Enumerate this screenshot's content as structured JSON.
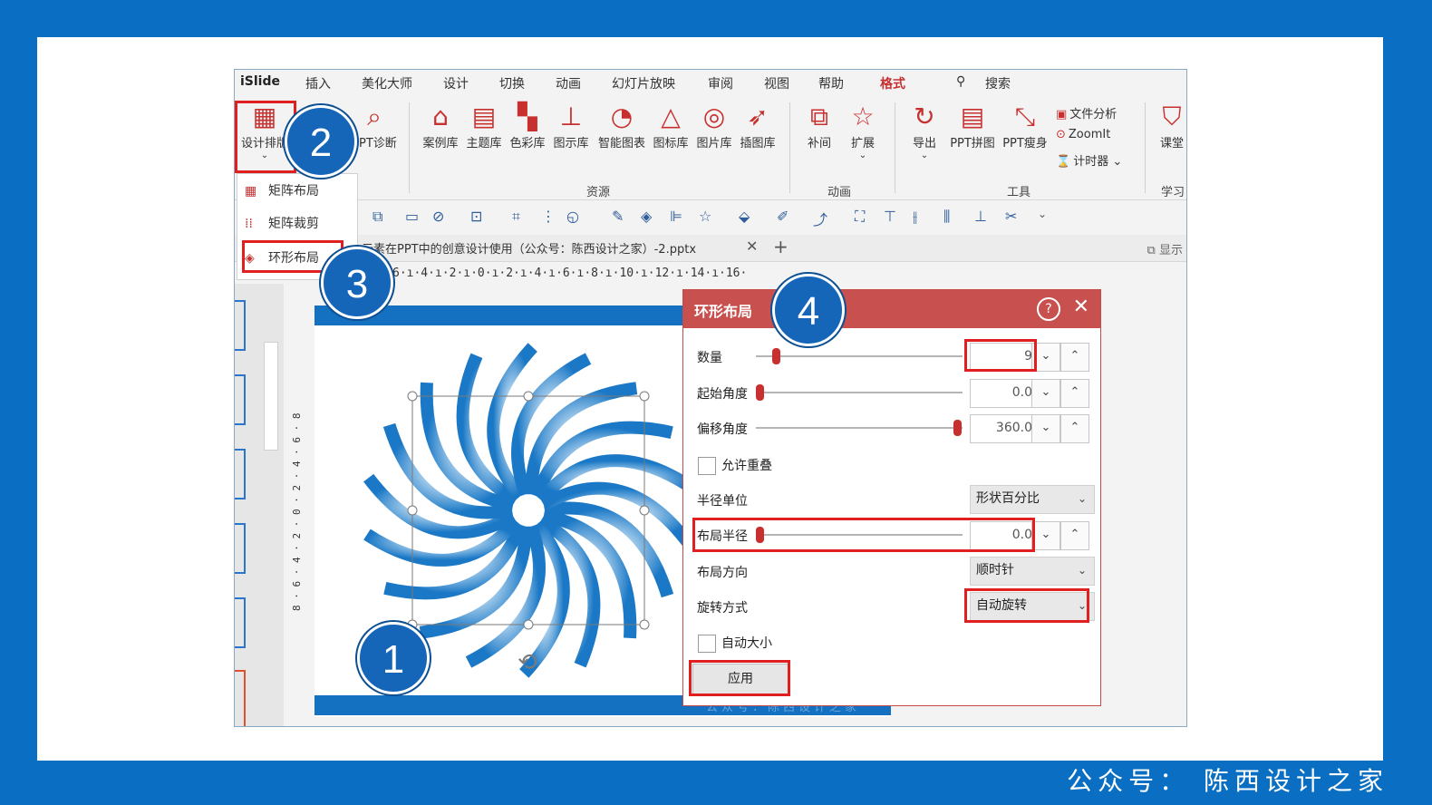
{
  "menubar": {
    "items": [
      "iSlide",
      "插入",
      "美化大师",
      "设计",
      "切换",
      "动画",
      "幻灯片放映",
      "审阅",
      "视图",
      "帮助",
      "格式"
    ],
    "search": "搜索"
  },
  "ribbon": {
    "design_layout": "设计排版",
    "ppt_diag": "PPT诊断",
    "resources": [
      "案例库",
      "主题库",
      "色彩库",
      "图示库",
      "智能图表",
      "图标库",
      "图片库",
      "插图库"
    ],
    "resources_group": "资源",
    "animation_items": [
      "补间",
      "扩展"
    ],
    "animation_group": "动画",
    "tools_items": [
      "导出",
      "PPT拼图",
      "PPT瘦身"
    ],
    "tools_small": [
      "文件分析",
      "ZoomIt",
      "计时器"
    ],
    "tools_group": "工具",
    "learn_item": "课堂",
    "learn_group": "学习"
  },
  "dropdown": {
    "items": [
      "矩阵布局",
      "矩阵裁剪",
      "环形布局"
    ]
  },
  "tabbar": {
    "doc_title": "元素在PPT中的创意设计使用（公众号：陈西设计之家）-2.pptx",
    "display": "显示"
  },
  "ruler": {
    "horizontal": "6·ı·4·ı·2·ı·0·ı·2·ı·4·ı·6·ı·8·ı·10·ı·12·ı·14·ı·16·",
    "vertical": "8 · 6 · 4 · 2 · 0 · 2 · 4 · 6 · 8"
  },
  "slide": {
    "footer_text": "公众号：陈西设计之家"
  },
  "dialog": {
    "title": "环形布局",
    "help_icon": "?",
    "rows": {
      "count_label": "数量",
      "count_value": "9",
      "start_angle_label": "起始角度",
      "start_angle_value": "0.0",
      "offset_angle_label": "偏移角度",
      "offset_angle_value": "360.0",
      "allow_overlap_label": "允许重叠",
      "radius_unit_label": "半径单位",
      "radius_unit_value": "形状百分比",
      "layout_radius_label": "布局半径",
      "layout_radius_value": "0.0",
      "direction_label": "布局方向",
      "direction_value": "顺时针",
      "rotation_label": "旋转方式",
      "rotation_value": "自动旋转",
      "auto_size_label": "自动大小"
    },
    "apply_label": "应用"
  },
  "steps": [
    "1",
    "2",
    "3",
    "4"
  ],
  "footer": {
    "brand": "公众号： 陈西设计之家"
  },
  "colors": {
    "frame": "#0a6fc2",
    "accent": "#c8302f",
    "dialog_title": "#c8504e",
    "highlight": "#e02020",
    "step": "#1565b8"
  }
}
